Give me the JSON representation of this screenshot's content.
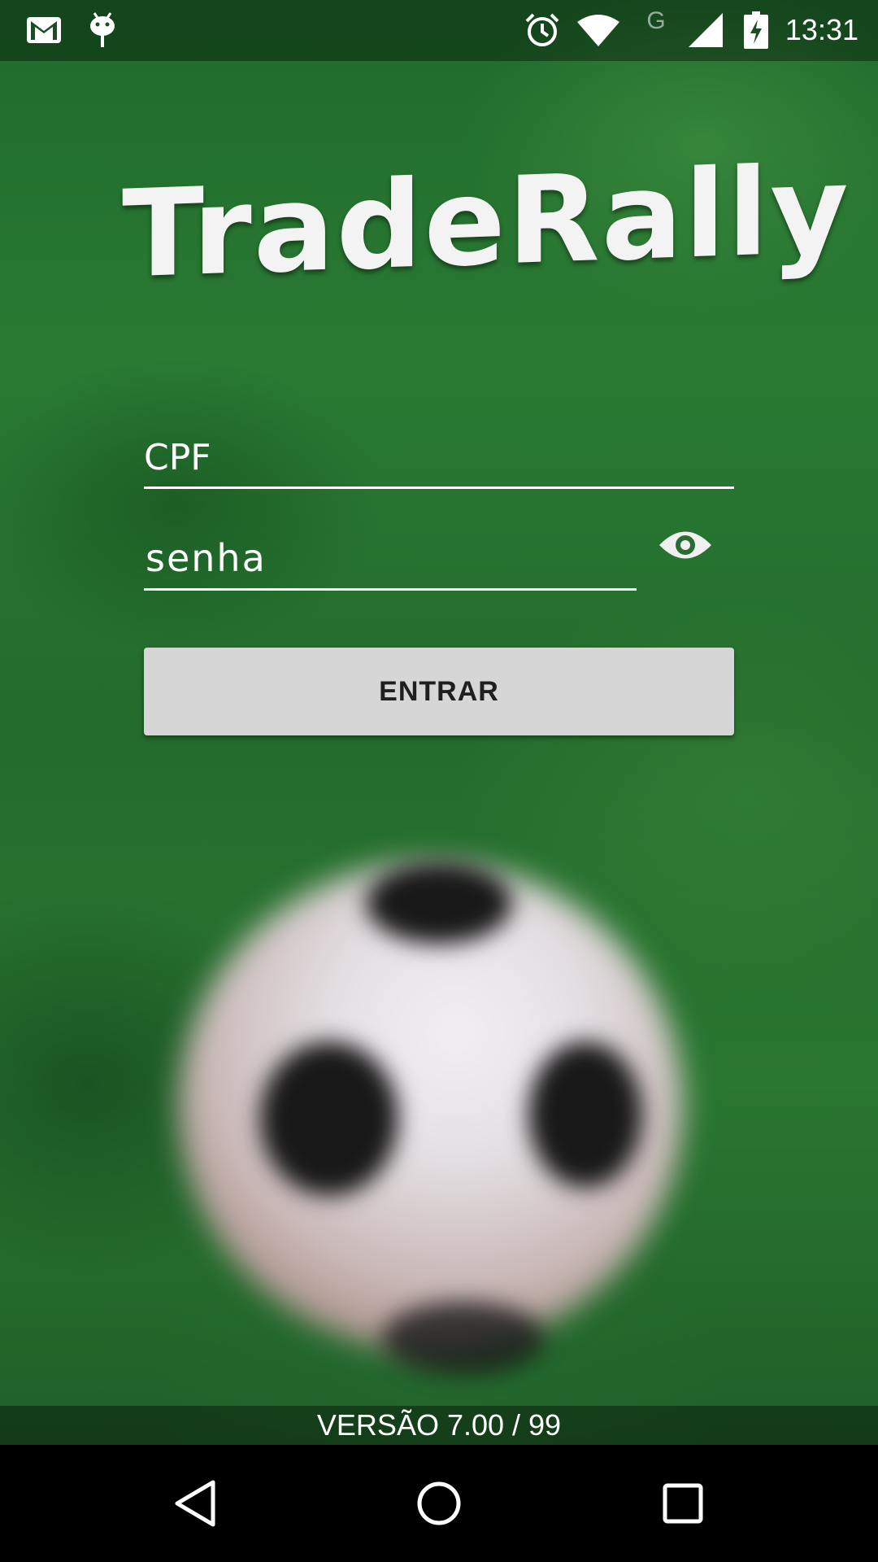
{
  "status_bar": {
    "time": "13:31",
    "icons": [
      "gmail-icon",
      "android-debug-icon",
      "alarm-icon",
      "wifi-icon",
      "network-g-icon",
      "signal-icon",
      "battery-charging-icon"
    ],
    "network_letter": "G"
  },
  "app": {
    "logo_text": "TradeRally"
  },
  "login": {
    "cpf_placeholder": "CPF",
    "password_placeholder": "senha",
    "show_password_icon": "eye-icon",
    "submit_label": "ENTRAR"
  },
  "footer": {
    "version": "VERSÃO 7.00 / 99"
  },
  "nav_bar": {
    "buttons": [
      "back-icon",
      "home-icon",
      "recents-icon"
    ]
  },
  "colors": {
    "button_bg": "#d6d6d6",
    "button_text": "#1f1f1f",
    "field_line": "#ffffff",
    "background": "#2a7a33"
  }
}
